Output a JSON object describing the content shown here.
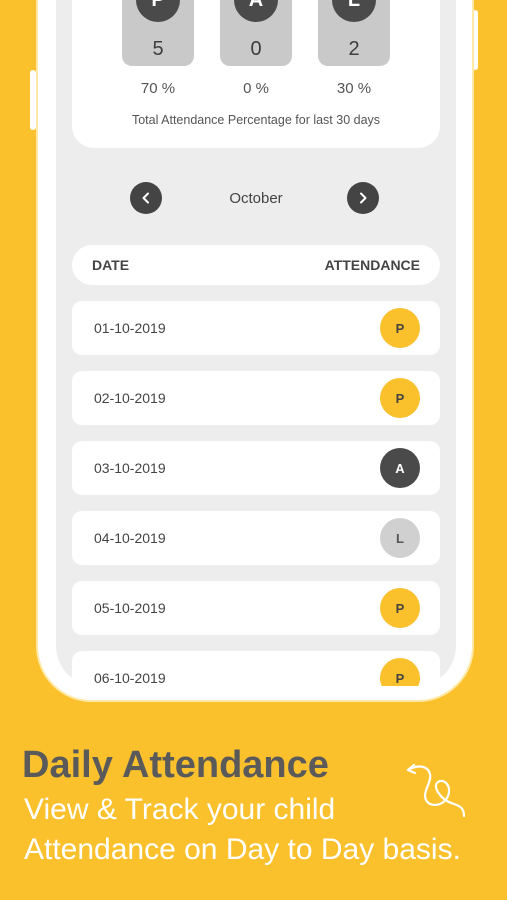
{
  "summary": {
    "stats": [
      {
        "letter": "P",
        "count": "5",
        "percent": "70 %"
      },
      {
        "letter": "A",
        "count": "0",
        "percent": "0 %"
      },
      {
        "letter": "L",
        "count": "2",
        "percent": "30 %"
      }
    ],
    "caption": "Total Attendance Percentage for last 30 days"
  },
  "month_nav": {
    "month": "October"
  },
  "table": {
    "headers": {
      "date": "DATE",
      "attendance": "ATTENDANCE"
    },
    "rows": [
      {
        "date": "01-10-2019",
        "status": "P"
      },
      {
        "date": "02-10-2019",
        "status": "P"
      },
      {
        "date": "03-10-2019",
        "status": "A"
      },
      {
        "date": "04-10-2019",
        "status": "L"
      },
      {
        "date": "05-10-2019",
        "status": "P"
      },
      {
        "date": "06-10-2019",
        "status": "P"
      }
    ]
  },
  "promo": {
    "title": "Daily Attendance",
    "subtitle_line1": "View & Track your child",
    "subtitle_line2": "Attendance on Day to Day basis."
  },
  "colors": {
    "background": "#FBC12D",
    "present": "#FBC12D",
    "absent": "#4A4A4A",
    "leave": "#D0D0D0"
  },
  "icons": [
    "chevron-left-icon",
    "chevron-right-icon",
    "swirl-arrow-icon"
  ]
}
